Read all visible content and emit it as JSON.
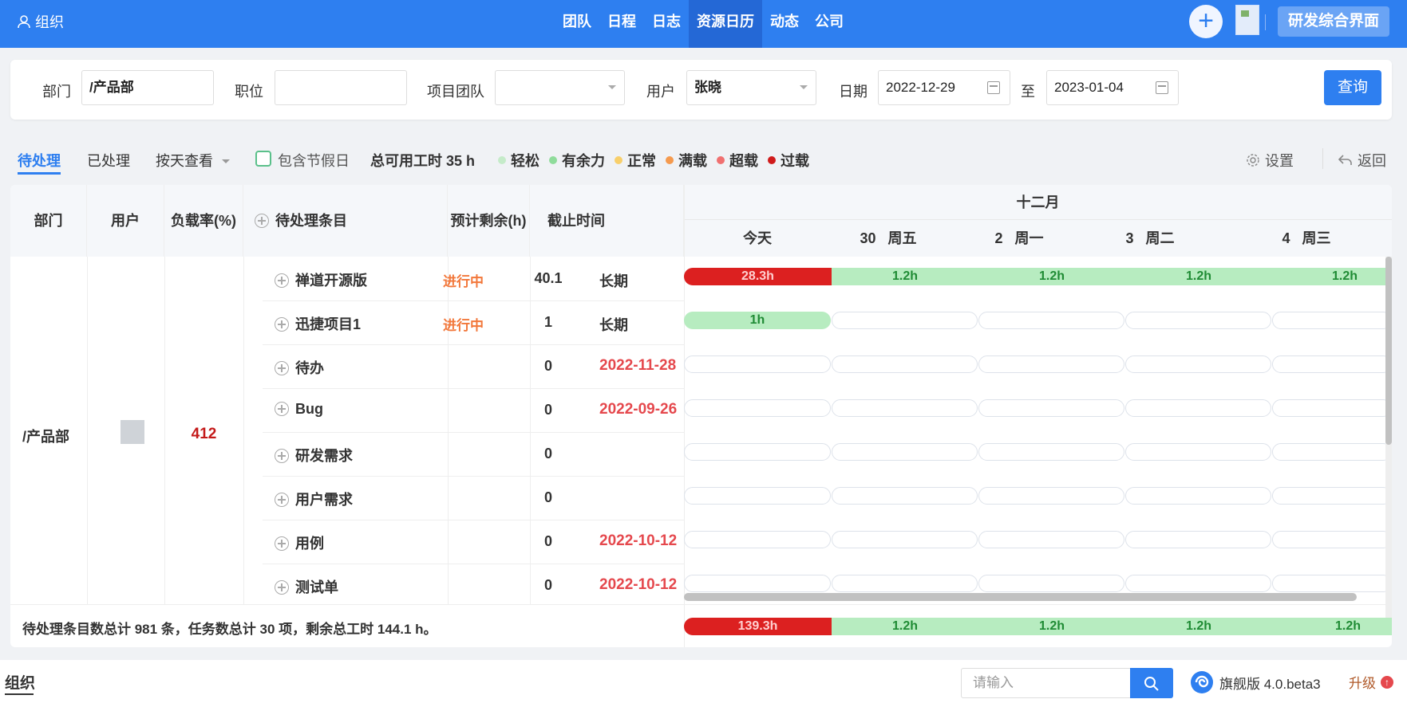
{
  "header": {
    "brand": "组织",
    "nav": [
      "团队",
      "日程",
      "日志",
      "资源日历",
      "动态",
      "公司"
    ],
    "active_nav": "资源日历",
    "add_label": "+",
    "workspace": "研发综合界面"
  },
  "filters": {
    "dept_label": "部门",
    "dept_value": "/产品部",
    "position_label": "职位",
    "position_value": "",
    "team_label": "项目团队",
    "team_value": "",
    "user_label": "用户",
    "user_value": "张晓",
    "date_label": "日期",
    "date_from": "2022-12-29",
    "to_label": "至",
    "date_to": "2023-01-04",
    "query": "查询"
  },
  "toolbar": {
    "tab_pending": "待处理",
    "tab_done": "已处理",
    "view_by": "按天查看",
    "include_holiday": "包含节假日",
    "total_hours": "总可用工时 35 h",
    "legend": [
      {
        "label": "轻松",
        "color": "#c5ebc9"
      },
      {
        "label": "有余力",
        "color": "#8fdc9b"
      },
      {
        "label": "正常",
        "color": "#f8cf6a"
      },
      {
        "label": "满载",
        "color": "#f59a4e"
      },
      {
        "label": "超载",
        "color": "#f07070"
      },
      {
        "label": "过载",
        "color": "#d01b1b"
      }
    ],
    "settings": "设置",
    "back": "返回"
  },
  "table": {
    "headers": {
      "dept": "部门",
      "user": "用户",
      "load": "负载率(%)",
      "items": "待处理条目",
      "remaining": "预计剩余(h)",
      "deadline": "截止时间"
    },
    "dept": "/产品部",
    "load": "412",
    "rows": [
      {
        "name": "禅道开源版",
        "status": "进行中",
        "remaining": "40.1",
        "deadline": "长期",
        "deadline_red": false
      },
      {
        "name": "迅捷项目1",
        "status": "进行中",
        "remaining": "1",
        "deadline": "长期",
        "deadline_red": false
      },
      {
        "name": "待办",
        "status": "",
        "remaining": "0",
        "deadline": "2022-11-28",
        "deadline_red": true
      },
      {
        "name": "Bug",
        "status": "",
        "remaining": "0",
        "deadline": "2022-09-26",
        "deadline_red": true
      },
      {
        "name": "研发需求",
        "status": "",
        "remaining": "0",
        "deadline": "",
        "deadline_red": false
      },
      {
        "name": "用户需求",
        "status": "",
        "remaining": "0",
        "deadline": "",
        "deadline_red": false
      },
      {
        "name": "用例",
        "status": "",
        "remaining": "0",
        "deadline": "2022-10-12",
        "deadline_red": true
      },
      {
        "name": "测试单",
        "status": "",
        "remaining": "0",
        "deadline": "2022-10-12",
        "deadline_red": true
      }
    ],
    "footer": "待处理条目数总计 981 条，任务数总计 30 项，剩余总工时 144.1 h。"
  },
  "calendar": {
    "month": "十二月",
    "days": [
      {
        "num": "",
        "weekday": "今天"
      },
      {
        "num": "30",
        "weekday": "周五"
      },
      {
        "num": "2",
        "weekday": "周一"
      },
      {
        "num": "3",
        "weekday": "周二"
      },
      {
        "num": "4",
        "weekday": "周三"
      }
    ],
    "row1": [
      "28.3h",
      "1.2h",
      "1.2h",
      "1.2h",
      "1.2h"
    ],
    "row2": [
      "1h"
    ],
    "totals": [
      "139.3h",
      "1.2h",
      "1.2h",
      "1.2h",
      "1.2h"
    ]
  },
  "bottom": {
    "tab": "组织",
    "search_placeholder": "请输入",
    "edition": "旗舰版 4.0.beta3",
    "upgrade": "升级"
  }
}
